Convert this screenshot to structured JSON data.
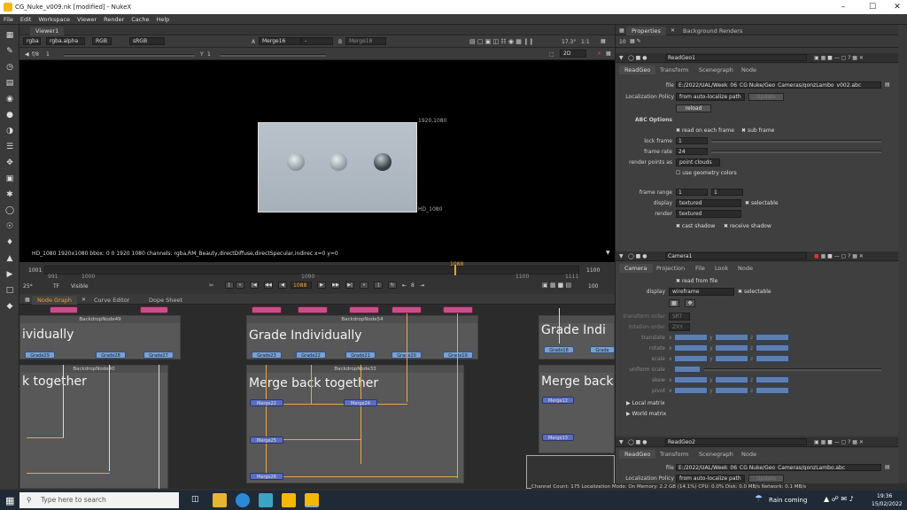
{
  "window": {
    "title": "CG_Nuke_v009.nk [modified] - NukeX"
  },
  "menu": [
    "File",
    "Edit",
    "Workspace",
    "Viewer",
    "Render",
    "Cache",
    "Help"
  ],
  "viewer": {
    "tab": "Viewer1",
    "channels": "rgba",
    "alpha": "rgba.alpha",
    "colorspace_mode": "RGB",
    "lut": "sRGB",
    "input_a": "Merge16",
    "input_a_op": "-",
    "input_b": "Merge18",
    "zoom": "17.3°",
    "ratio": "1:1",
    "view": "2D",
    "gain_label": "f/8",
    "gain_value": "1",
    "gamma_label": "Y",
    "gamma_value": "1",
    "res_label": "1920,1080",
    "format_label": "HD_1080",
    "info_line": "HD_1080 1920x1080  bbox: 0 0 1920 1080 channels: rgba,RM_Beauty,directDiffuse,directSpecular,indirec  x=0 y=0"
  },
  "timeline": {
    "start": "1001",
    "end": "1100",
    "ticks": [
      "991",
      "1000",
      "1090",
      "1100",
      "1111"
    ],
    "current": "1088",
    "current_field": "1088",
    "fps": "25*",
    "tf": "TF",
    "visible": "Visible",
    "step": "8",
    "end_field": "100"
  },
  "nodegraph": {
    "tabs": [
      "Node Graph",
      "Curve Editor",
      "Dope Sheet"
    ],
    "backdrops": [
      {
        "title": "BackdropNode49",
        "text": "ividually"
      },
      {
        "title": "BackdropNode40",
        "text": "k together"
      },
      {
        "title": "BackdropNode54",
        "text": "Grade Individually"
      },
      {
        "title": "BackdropNode33",
        "text": "Merge back together"
      },
      {
        "title": "",
        "text": "Grade Indi"
      },
      {
        "title": "",
        "text": "Merge back"
      }
    ],
    "grade_nodes": [
      "Grade29",
      "Grade28",
      "Grade27",
      "Grade23",
      "Grade22",
      "Grade21",
      "Grade20",
      "Grade19",
      "Grade18",
      "Grade"
    ],
    "merge_nodes": [
      "Merge22",
      "Merge24",
      "Merge25",
      "Merge26",
      "Merge12",
      "Merge13"
    ]
  },
  "props": {
    "tabs": [
      "Properties",
      "Background Renders"
    ],
    "max_panels": "10",
    "readgeo1": {
      "name": "ReadGeo1",
      "tabs": [
        "ReadGeo",
        "Transform",
        "Scenegraph",
        "Node"
      ],
      "file_label": "file",
      "file": "E:/2022/UAL/Week_06_CG Nuke/Geo_Cameras/gonzLambo_v002.abc",
      "localization_label": "Localization Policy",
      "localization": "from auto-localize path",
      "update": "Update",
      "reload": "reload",
      "abc_options": "ABC Options",
      "read_each_frame": "read on each frame",
      "sub_frame": "sub frame",
      "lock_frame_label": "lock frame",
      "lock_frame": "1",
      "frame_rate_label": "frame rate",
      "frame_rate": "24",
      "render_points_label": "render points as",
      "render_points": "point clouds",
      "use_geo_colors": "use geometry colors",
      "frame_range_label": "frame range",
      "frame_range_a": "1",
      "frame_range_b": "1",
      "display_label": "display",
      "display": "textured",
      "selectable": "selectable",
      "render_label": "render",
      "render": "textured",
      "cast_shadow": "cast shadow",
      "receive_shadow": "receive shadow"
    },
    "camera1": {
      "name": "Camera1",
      "tabs": [
        "Camera",
        "Projection",
        "File",
        "Look",
        "Node"
      ],
      "read_from_file": "read from file",
      "display_label": "display",
      "display": "wireframe",
      "selectable": "selectable",
      "transform_order_label": "transform order",
      "transform_order": "SRT",
      "rotation_order_label": "rotation order",
      "rotation_order": "ZXY",
      "translate_label": "translate",
      "rotate_label": "rotate",
      "scale_label": "scale",
      "uniform_scale_label": "uniform scale",
      "skew_label": "skew",
      "pivot_label": "pivot",
      "axis_x": "x",
      "axis_y": "y",
      "axis_z": "z",
      "local_matrix": "Local matrix",
      "world_matrix": "World matrix"
    },
    "readgeo2": {
      "name": "ReadGeo2",
      "tabs": [
        "ReadGeo",
        "Transform",
        "Scenegraph",
        "Node"
      ],
      "file_label": "file",
      "file": "E:/2022/UAL/Week_06_CG Nuke/Geo_Cameras/gonzLambo.abc",
      "localization_label": "Localization Policy",
      "localization": "from auto-localize path",
      "update": "Update"
    }
  },
  "status": "Channel Count: 175  Localization Mode: On  Memory: 2.2 GB (14.1%)  CPU: 0.0%  Disk: 0.0 MB/s  Network: 0.1 MB/s",
  "taskbar": {
    "search_placeholder": "Type here to search",
    "weather": "Rain coming",
    "time": "19:36",
    "date": "15/02/2022"
  },
  "colors": {
    "accent": "#f0a030",
    "grade_node": "#7aa0d0",
    "merge_node": "#5b6ec0",
    "backdrop": "#585858"
  }
}
